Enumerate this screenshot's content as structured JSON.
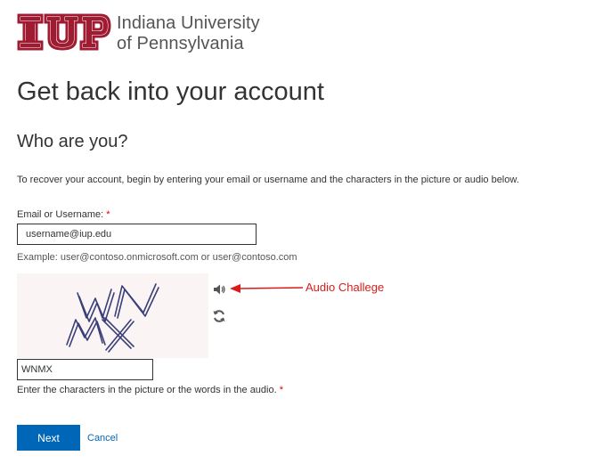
{
  "logo": {
    "mark_text": "IUP",
    "line1": "Indiana University",
    "line2": "of Pennsylvania",
    "mark_color": "#9e1b32"
  },
  "page": {
    "title": "Get back into your account",
    "subtitle": "Who are you?",
    "intro": "To recover your account, begin by entering your email or username and the characters in the picture or audio below."
  },
  "email": {
    "label": "Email or Username:",
    "required_marker": "*",
    "value": "username@iup.edu",
    "example": "Example: user@contoso.onmicrosoft.com or user@contoso.com"
  },
  "captcha": {
    "image_text": "WNMX",
    "audio_icon": "speaker-icon",
    "refresh_icon": "refresh-icon",
    "input_value": "WNMX",
    "help": "Enter the characters in the picture or the words in the audio.",
    "required_marker": "*"
  },
  "annotation": {
    "text": "Audio Challege",
    "color": "#d81c1c"
  },
  "buttons": {
    "next_label": "Next",
    "cancel_label": "Cancel",
    "accent": "#0067b8"
  }
}
